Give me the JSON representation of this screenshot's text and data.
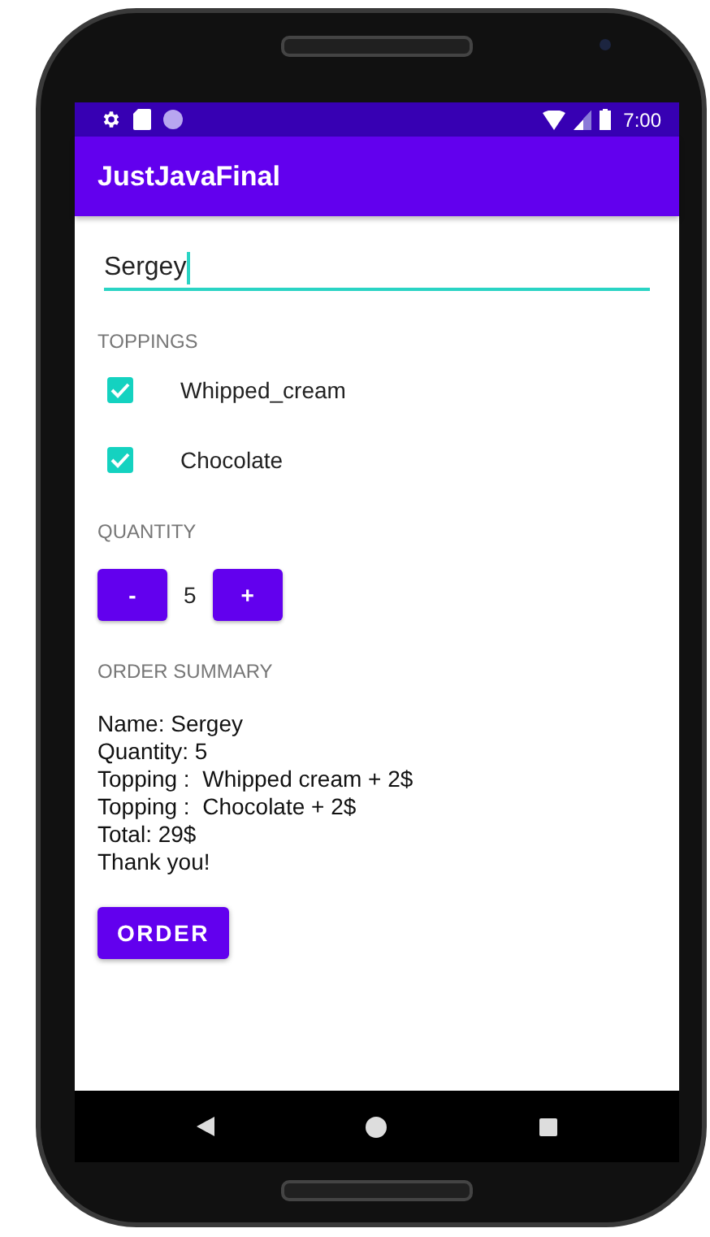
{
  "status_bar": {
    "time": "7:00"
  },
  "app_bar": {
    "title": "JustJavaFinal"
  },
  "name_field": {
    "value": "Sergey",
    "focused": true
  },
  "toppings": {
    "label": "TOPPINGS",
    "items": [
      {
        "label": "Whipped_cream",
        "checked": true
      },
      {
        "label": "Chocolate",
        "checked": true
      }
    ]
  },
  "quantity": {
    "label": "QUANTITY",
    "decrement": "-",
    "value": "5",
    "increment": "+"
  },
  "order_summary": {
    "label": "ORDER SUMMARY",
    "lines": [
      "Name: Sergey",
      "Quantity: 5",
      "Topping :  Whipped cream + 2$",
      "Topping :  Chocolate + 2$",
      "Total: 29$",
      "Thank you!"
    ]
  },
  "order_button": "ORDER"
}
